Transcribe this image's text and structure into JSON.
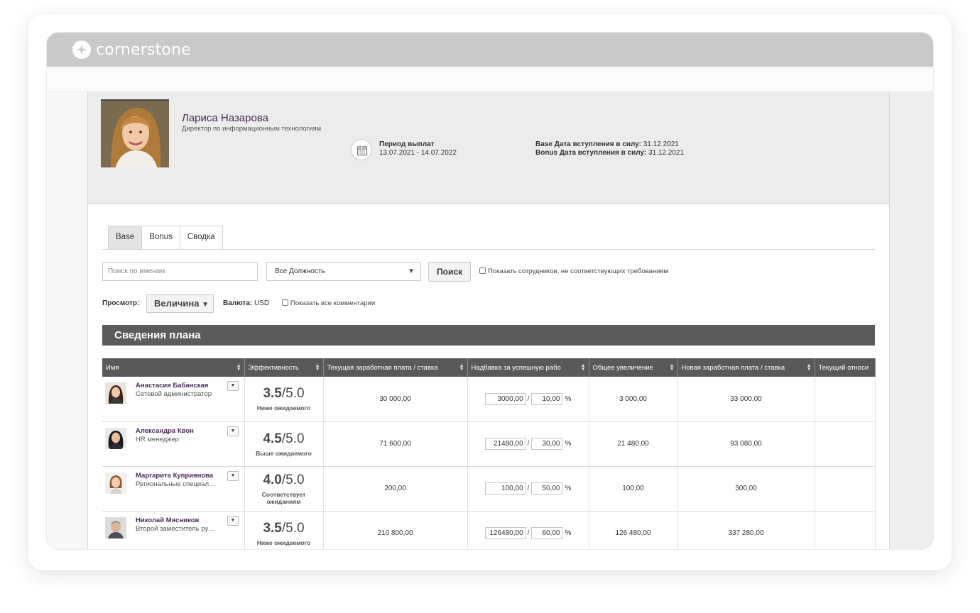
{
  "brand": {
    "name": "cornerstone"
  },
  "profile": {
    "name": "Лариса Назарова",
    "role": "Директор по информационным технологиям",
    "period_label": "Период выплат",
    "period_value": "13.07.2021 - 14.07.2022",
    "base_date_label": "Base Дата вступления в силу:",
    "base_date_value": "31.12.2021",
    "bonus_date_label": "Bonus Дата вступления в силу:",
    "bonus_date_value": "31.12.2021"
  },
  "tabs": [
    {
      "label": "Base",
      "active": true
    },
    {
      "label": "Bonus",
      "active": false
    },
    {
      "label": "Сводка",
      "active": false
    }
  ],
  "filters": {
    "search_placeholder": "Поиск по именам",
    "position_select": "Все Должность",
    "search_button": "Поиск",
    "show_noncompliant_label": "Показать сотрудников, не соответствующих требованиям"
  },
  "view": {
    "label": "Просмотр:",
    "selected": "Величина",
    "currency_label": "Валюта:",
    "currency_value": "USD",
    "show_comments_label": "Показать все комментарии"
  },
  "plan": {
    "title": "Сведения плана",
    "columns": [
      "Имя",
      "Эффективность",
      "Текущая заработная плата / ставка",
      "Надбавка за успешную рабо",
      "Общее увеличение",
      "Новая заработная плата / ставка",
      "Текущий относи"
    ],
    "rows": [
      {
        "name": "Анастасия Бабанская",
        "role": "Сетевой администратор",
        "score": "3.5",
        "score_max": "/5.0",
        "score_label": "Ниже ожидаемого",
        "current_salary": "30 000,00",
        "merit_amount": "3000,00",
        "merit_percent": "10,00",
        "total_increase": "3 000,00",
        "new_salary": "33 000,00",
        "current_relative": ""
      },
      {
        "name": "Александра Квон",
        "role": "HR менеджер",
        "score": "4.5",
        "score_max": "/5.0",
        "score_label": "Выше ожидаемого",
        "current_salary": "71 600,00",
        "merit_amount": "21480,00",
        "merit_percent": "30,00",
        "total_increase": "21 480,00",
        "new_salary": "93 080,00",
        "current_relative": ""
      },
      {
        "name": "Маргарита Куприянова",
        "role": "Региональные специал…",
        "score": "4.0",
        "score_max": "/5.0",
        "score_label": "Соответствует ожиданиям",
        "current_salary": "200,00",
        "merit_amount": "100,00",
        "merit_percent": "50,00",
        "total_increase": "100,00",
        "new_salary": "300,00",
        "current_relative": ""
      },
      {
        "name": "Николай Мясников",
        "role": "Второй заместитель ру…",
        "score": "3.5",
        "score_max": "/5.0",
        "score_label": "Ниже ожидаемого",
        "current_salary": "210 800,00",
        "merit_amount": "126480,00",
        "merit_percent": "60,00",
        "total_increase": "126 480,00",
        "new_salary": "337 280,00",
        "current_relative": ""
      }
    ]
  },
  "colors": {
    "brand_bar": "#c9c9c9",
    "name_purple": "#4b2a59",
    "header_dark": "#595959",
    "plan_bar": "#5b5b5b"
  }
}
